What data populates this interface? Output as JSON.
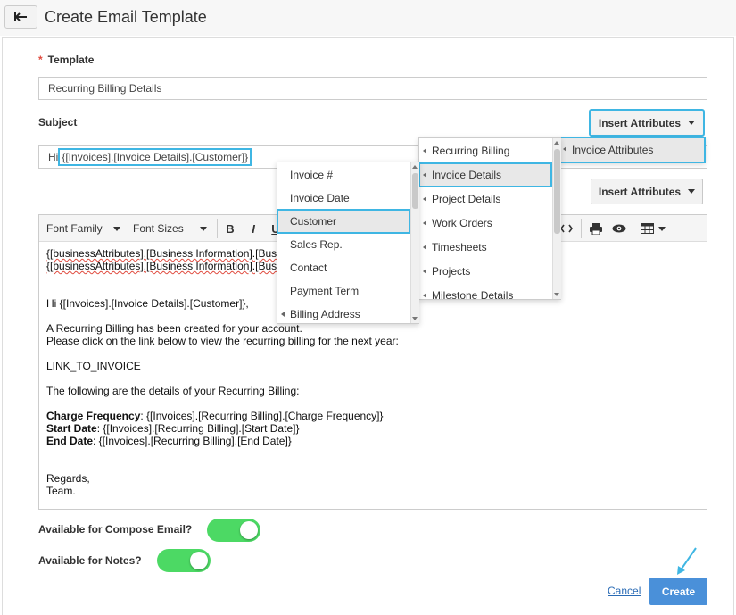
{
  "header": {
    "title": "Create Email Template"
  },
  "form": {
    "template_label": "Template",
    "template_value": "Recurring Billing Details",
    "subject_label": "Subject",
    "subject_prefix": "Hi",
    "subject_token": "{[Invoices].[Invoice Details].[Customer]}",
    "insert_attributes_label": "Insert Attributes",
    "insert_attributes_label_2": "Insert Attributes"
  },
  "toolbar": {
    "font_family": "Font Family",
    "font_sizes": "Font Sizes",
    "bold": "B",
    "italic": "I",
    "underline": "U"
  },
  "editor": {
    "line1a": "{[businessAttributes].[Business Information].[Bus",
    "line2a": "{[businessAttributes].[Business Information].[Bus",
    "greeting": "Hi {[Invoices].[Invoice Details].[Customer]},",
    "para1": "A Recurring Billing has been created for your account.",
    "para2": "Please click on the link below to view the recurring billing for the next year:",
    "link": "LINK_TO_INVOICE",
    "details_intro": "The following are the details of your Recurring Billing:",
    "charge_label": "Charge Frequency",
    "charge_value": ": {[Invoices].[Recurring Billing].[Charge Frequency]}",
    "start_label": "Start Date",
    "start_value": ": {[Invoices].[Recurring Billing].[Start Date]}",
    "end_label": "End Date",
    "end_value": ": {[Invoices].[Recurring Billing].[End Date]}",
    "regards": "Regards,",
    "team": "Team."
  },
  "toggles": {
    "compose_label": "Available for Compose Email?",
    "compose_on": true,
    "notes_label": "Available for Notes?",
    "notes_on": true
  },
  "actions": {
    "cancel": "Cancel",
    "create": "Create"
  },
  "menus": {
    "level1": {
      "items": [
        "Invoice Attributes"
      ],
      "selected": "Invoice Attributes"
    },
    "level2": {
      "items": [
        "Recurring Billing",
        "Invoice Details",
        "Project Details",
        "Work Orders",
        "Timesheets",
        "Projects",
        "Milestone Details"
      ],
      "selected": "Invoice Details"
    },
    "level3": {
      "items": [
        "Invoice #",
        "Invoice Date",
        "Customer",
        "Sales Rep.",
        "Contact",
        "Payment Term",
        "Billing Address"
      ],
      "selected": "Customer"
    }
  },
  "colors": {
    "highlight": "#3fb6e3",
    "toggle_on": "#4cd964",
    "primary": "#4a90d9",
    "link": "#2a6bb5",
    "required": "#e04b3f"
  }
}
